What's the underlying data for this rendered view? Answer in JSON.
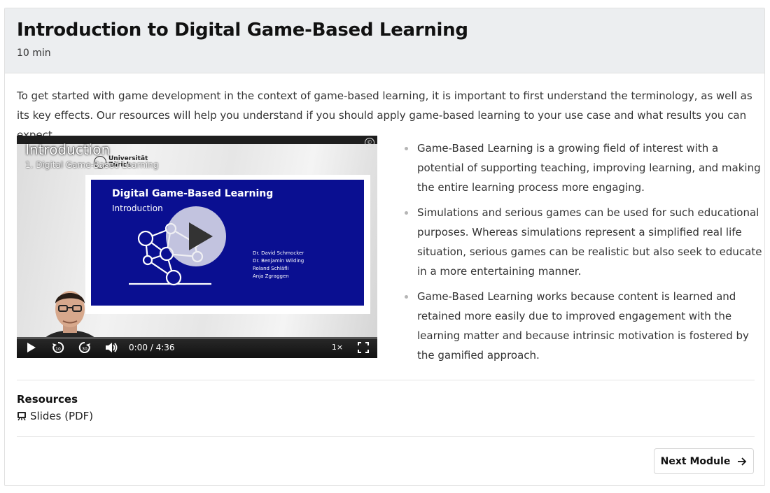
{
  "module": {
    "title": "Introduction to Digital Game-Based Learning",
    "duration": "10 min",
    "intro": "To get started with game development in the context of game-based learning, it is important to first understand the terminology, as well as its key effects. Our resources will help you understand if you should apply game-based learning to your use case and what results you can expect."
  },
  "video": {
    "title": "Introduction",
    "subtitle": "1. Digital Game-Based Learning",
    "logo_text_line1": "Universität",
    "logo_text_line2": "Zürich",
    "slide_title": "Digital Game-Based Learning",
    "slide_subtitle": "Introduction",
    "authors": [
      "Dr. David Schmocker",
      "Dr. Benjamin Wilding",
      "Roland Schläfli",
      "Anja Zgraggen"
    ],
    "time": "0:00 / 4:36",
    "speed": "1×",
    "progress": 0,
    "cc_icon": "copyright-icon",
    "play_icon": "play-icon"
  },
  "bullets": [
    "Game-Based Learning is a growing field of interest with a potential of supporting teaching, improving learning, and making the entire learning process more engaging.",
    "Simulations and serious games can be used for such educational purposes. Whereas simulations represent a simplified real life situation, serious games can be realistic but also seek to educate in a more entertaining manner.",
    "Game-Based Learning works because content is learned and retained more easily due to improved engagement with the learning matter and because intrinsic motivation is fostered by the gamified approach."
  ],
  "resources": {
    "heading": "Resources",
    "items": [
      {
        "label": "Slides (PDF)",
        "icon": "presentation-icon"
      }
    ]
  },
  "navigation": {
    "next_label": "Next Module",
    "next_icon": "arrow-right-icon"
  },
  "colors": {
    "header_bg": "#eceef0",
    "slide_blue": "#0a0f91",
    "text": "#333333"
  }
}
